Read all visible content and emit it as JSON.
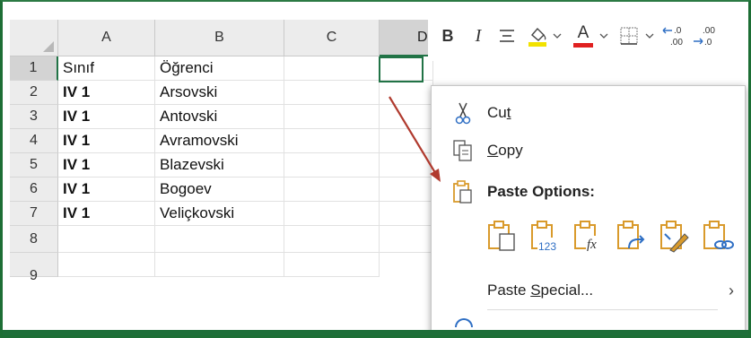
{
  "columns": [
    "A",
    "B",
    "C",
    "D"
  ],
  "rows": [
    {
      "num": "1",
      "a": "Sınıf",
      "b": "Öğrenci"
    },
    {
      "num": "2",
      "a": "IV 1",
      "b": "Arsovski"
    },
    {
      "num": "3",
      "a": "IV 1",
      "b": "Antovski"
    },
    {
      "num": "4",
      "a": "IV 1",
      "b": "Avramovski"
    },
    {
      "num": "5",
      "a": "IV 1",
      "b": "Blazevski"
    },
    {
      "num": "6",
      "a": "IV 1",
      "b": "Bogoev"
    },
    {
      "num": "7",
      "a": "IV 1",
      "b": "Veliçkovski"
    },
    {
      "num": "8",
      "a": "",
      "b": ""
    },
    {
      "num": "9",
      "a": "",
      "b": ""
    }
  ],
  "toolbar": {
    "bold": "B",
    "italic": "I",
    "font_color_letter": "A",
    "inc_decimal_top": ".0",
    "inc_decimal_bottom": ".00",
    "dec_decimal_top": ".00",
    "dec_decimal_bottom": ".0",
    "highlight_color": "#f2e200",
    "font_color": "#e02020"
  },
  "context_menu": {
    "cut_pre": "Cu",
    "cut_key": "t",
    "copy_key": "C",
    "copy_post": "opy",
    "paste_options": "Paste Options:",
    "paste_special_pre": "Paste ",
    "paste_special_key": "S",
    "paste_special_post": "pecial...",
    "paste_special_chevron": "›",
    "paste_icon_names": [
      "paste",
      "paste-values",
      "paste-formulas",
      "paste-transpose",
      "paste-formatting",
      "paste-link"
    ],
    "paste_values_badge": "123",
    "paste_formulas_badge": "fx"
  },
  "colors": {
    "accent": "#217346",
    "clipboard": "#d99a2b",
    "arrow": "#b03a2e"
  }
}
